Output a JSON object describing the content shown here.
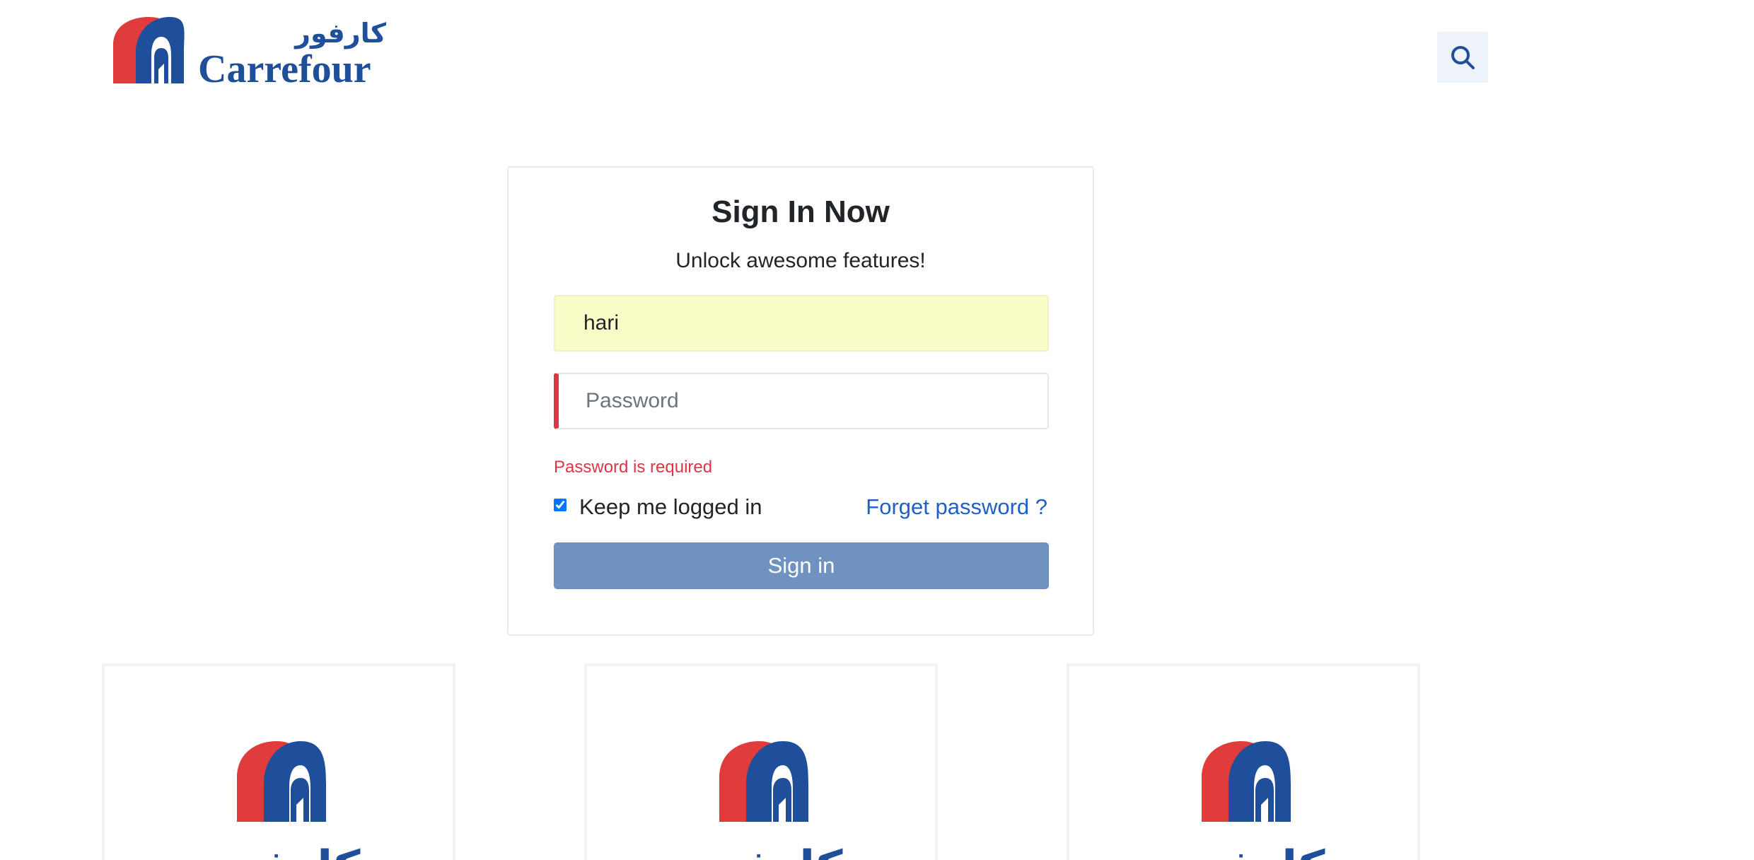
{
  "brand": {
    "name_latin": "Carrefour",
    "name_arabic": "كارفور"
  },
  "header": {
    "search_icon": "search-icon"
  },
  "signin": {
    "title": "Sign In Now",
    "subtitle": "Unlock awesome features!",
    "username_value": "hari",
    "password_placeholder": "Password",
    "password_error": "Password is required",
    "remember_label": "Keep me logged in",
    "remember_checked": true,
    "forgot_label": "Forget password ?",
    "submit_label": "Sign in"
  },
  "colors": {
    "brand_red": "#e03c3c",
    "brand_blue": "#1f4f9a",
    "button": "#7092c0",
    "error": "#dc3545",
    "link": "#1f5fc9",
    "autofill": "#fafcc7"
  },
  "tiles": [
    {
      "icon": "carrefour-logo"
    },
    {
      "icon": "carrefour-logo"
    },
    {
      "icon": "carrefour-logo"
    }
  ]
}
